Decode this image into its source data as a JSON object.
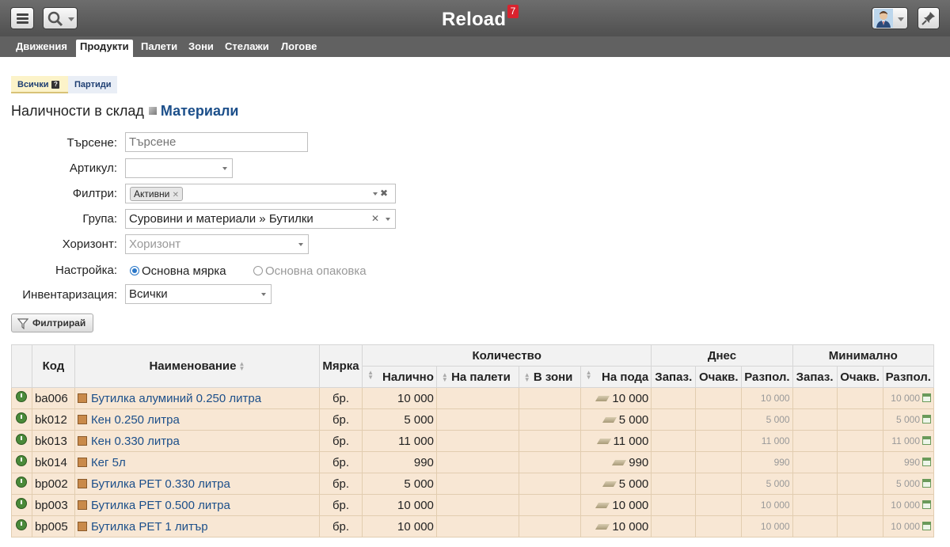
{
  "app": {
    "title": "Reload",
    "notifications": "7"
  },
  "nav": [
    {
      "label": "Движения",
      "active": false
    },
    {
      "label": "Продукти",
      "active": true
    },
    {
      "label": "Палети",
      "active": false
    },
    {
      "label": "Зони",
      "active": false
    },
    {
      "label": "Стелажи",
      "active": false
    },
    {
      "label": "Логове",
      "active": false
    }
  ],
  "subtabs": {
    "all": "Всички",
    "batches": "Партиди"
  },
  "heading": {
    "prefix": "Наличности в склад",
    "store": "Материали"
  },
  "form": {
    "search": {
      "label": "Търсене:",
      "placeholder": "Търсене"
    },
    "article": {
      "label": "Артикул:",
      "value": ""
    },
    "filters": {
      "label": "Филтри:",
      "chip": "Активни"
    },
    "group": {
      "label": "Група:",
      "value": "Суровини и материали » Бутилки"
    },
    "horizon": {
      "label": "Хоризонт:",
      "placeholder": "Хоризонт"
    },
    "setting": {
      "label": "Настройка:",
      "option1": "Основна мярка",
      "option2": "Основна опаковка",
      "selected": "option1"
    },
    "inventory": {
      "label": "Инвентаризация:",
      "value": "Всички"
    },
    "filter_button": "Филтрирай"
  },
  "table": {
    "headers": {
      "code": "Код",
      "name": "Наименование",
      "unit": "Мярка",
      "quantity": "Количество",
      "today": "Днес",
      "minimum": "Минимално",
      "available": "Налично",
      "on_pallets": "На палети",
      "in_zones": "В зони",
      "on_floor": "На пода",
      "reserved": "Запаз.",
      "expected": "Очакв.",
      "disposable": "Разпол."
    },
    "rows": [
      {
        "code": "ba006",
        "name": "Бутилка алуминий 0.250 литра",
        "unit": "бр.",
        "available": "10 000",
        "on_floor": "10 000",
        "today_disp": "10 000",
        "min_disp": "10 000"
      },
      {
        "code": "bk012",
        "name": "Кен 0.250 литра",
        "unit": "бр.",
        "available": "5 000",
        "on_floor": "5 000",
        "today_disp": "5 000",
        "min_disp": "5 000"
      },
      {
        "code": "bk013",
        "name": "Кен 0.330 литра",
        "unit": "бр.",
        "available": "11 000",
        "on_floor": "11 000",
        "today_disp": "11 000",
        "min_disp": "11 000"
      },
      {
        "code": "bk014",
        "name": "Кег 5л",
        "unit": "бр.",
        "available": "990",
        "on_floor": "990",
        "today_disp": "990",
        "min_disp": "990"
      },
      {
        "code": "bp002",
        "name": "Бутилка PET 0.330 литра",
        "unit": "бр.",
        "available": "5 000",
        "on_floor": "5 000",
        "today_disp": "5 000",
        "min_disp": "5 000"
      },
      {
        "code": "bp003",
        "name": "Бутилка PET 0.500 литра",
        "unit": "бр.",
        "available": "10 000",
        "on_floor": "10 000",
        "today_disp": "10 000",
        "min_disp": "10 000"
      },
      {
        "code": "bp005",
        "name": "Бутилка PET 1 литър",
        "unit": "бр.",
        "available": "10 000",
        "on_floor": "10 000",
        "today_disp": "10 000",
        "min_disp": "10 000"
      }
    ]
  }
}
